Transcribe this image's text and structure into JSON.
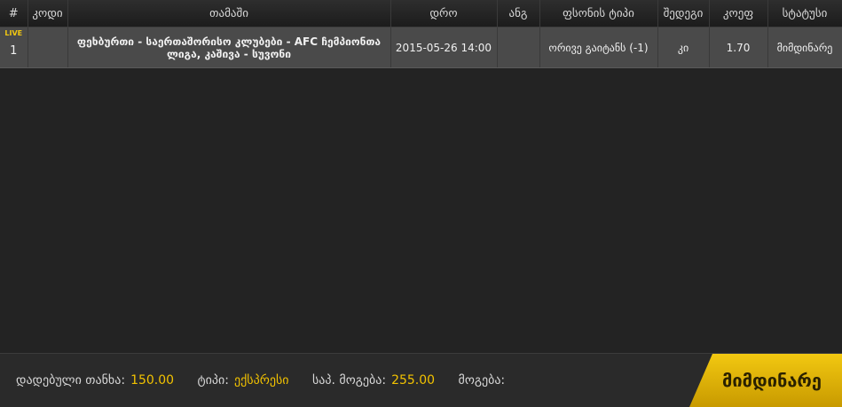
{
  "table": {
    "headers": {
      "num": "#",
      "code": "კოდი",
      "game": "თამაში",
      "time": "დრო",
      "score": "ანგ",
      "bet_type": "ფსონის ტიპი",
      "outcome": "შედეგი",
      "coef": "კოეფ",
      "status": "სტატუსი"
    },
    "rows": [
      {
        "live": "LIVE",
        "num": "1",
        "code": "",
        "game": "ფეხბურთი - საერთაშორისო კლუბები - AFC ჩემპიონთა ლიგა, კაშივა - სუვონი",
        "time": "2015-05-26 14:00",
        "score": "",
        "bet_type": "ორივე გაიტანს (-1)",
        "outcome": "კი",
        "coef": "1.70",
        "status": "მიმდინარე"
      }
    ]
  },
  "footer": {
    "stake_label": "დადებული თანხა:",
    "stake_value": "150.00",
    "type_label": "ტიპი:",
    "type_value": "ექსპრესი",
    "potential_label": "საპ. მოგება:",
    "potential_value": "255.00",
    "win_label": "მოგება:",
    "win_value": "",
    "status_button": "მიმდინარე"
  },
  "colors": {
    "accent": "#f2c811",
    "row_bg": "#4a4a4a",
    "body_bg": "#232323"
  }
}
